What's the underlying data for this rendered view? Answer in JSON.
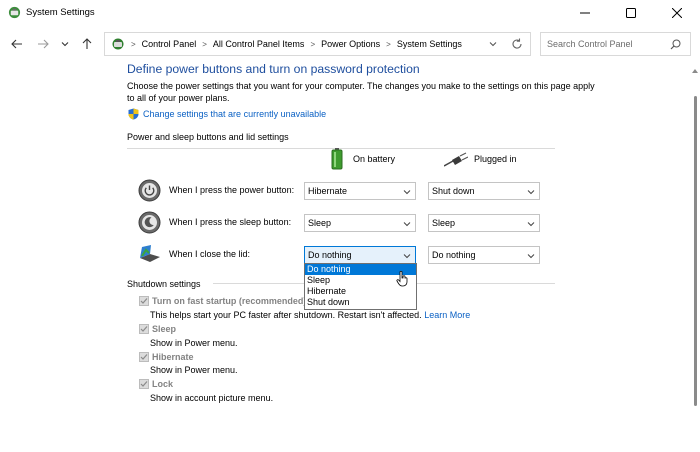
{
  "window": {
    "title": "System Settings",
    "accent": "#0078d7"
  },
  "address": {
    "crumbs": [
      "Control Panel",
      "All Control Panel Items",
      "Power Options",
      "System Settings"
    ],
    "search_placeholder": "Search Control Panel"
  },
  "page": {
    "title": "Define power buttons and turn on password protection",
    "description": "Choose the power settings that you want for your computer. The changes you make to the settings on this page apply to all of your power plans.",
    "change_link": "Change settings that are currently unavailable"
  },
  "power_section": {
    "label": "Power and sleep buttons and lid settings",
    "col_battery": "On battery",
    "col_plugged": "Plugged in",
    "rows": [
      {
        "label": "When I press the power button:",
        "battery": "Hibernate",
        "plugged": "Shut down"
      },
      {
        "label": "When I press the sleep button:",
        "battery": "Sleep",
        "plugged": "Sleep"
      },
      {
        "label": "When I close the lid:",
        "battery": "Do nothing",
        "plugged": "Do nothing"
      }
    ]
  },
  "dropdown": {
    "options": [
      "Do nothing",
      "Sleep",
      "Hibernate",
      "Shut down"
    ],
    "selected": "Do nothing"
  },
  "shutdown_section": {
    "label": "Shutdown settings",
    "items": [
      {
        "title": "Turn on fast startup (recommended)",
        "desc": "This helps start your PC faster after shutdown. Restart isn't affected.",
        "link": "Learn More"
      },
      {
        "title": "Sleep",
        "desc": "Show in Power menu."
      },
      {
        "title": "Hibernate",
        "desc": "Show in Power menu."
      },
      {
        "title": "Lock",
        "desc": "Show in account picture menu."
      }
    ]
  },
  "icons": {
    "app": "power-options-icon",
    "back": "back-arrow-icon",
    "forward": "forward-arrow-icon",
    "recent": "chevron-down-icon",
    "up": "up-arrow-icon",
    "refresh": "refresh-icon",
    "search": "search-icon",
    "shield": "uac-shield-icon",
    "battery": "battery-icon",
    "plug": "plug-icon",
    "power_button": "power-button-icon",
    "sleep_button": "sleep-button-icon",
    "lid": "laptop-lid-icon"
  }
}
